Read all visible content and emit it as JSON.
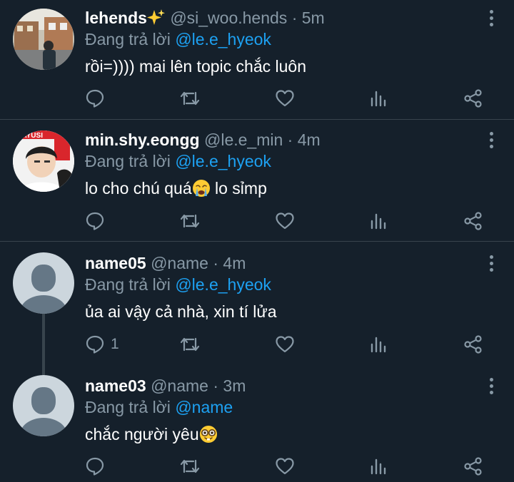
{
  "colors": {
    "background": "#15202b",
    "divider": "#38444d",
    "muted": "#8899a6",
    "accent": "#1da1f2"
  },
  "tweets": [
    {
      "display_name": "lehends",
      "name_emoji": "sparkles-icon",
      "handle": "@si_woo.hends",
      "separator": "·",
      "time": "5m",
      "replying_prefix": "Đang trả lời",
      "replying_to": "@le.e_hyeok",
      "text": "rồi=)))) mai lên topic chắc luôn",
      "reply_count": ""
    },
    {
      "display_name": "min.shy.eongg",
      "handle": "@le.e_min",
      "separator": "·",
      "time": "4m",
      "replying_prefix": "Đang trả lời",
      "replying_to": "@le.e_hyeok",
      "text_before": "lo cho chú quá",
      "text_emoji": "loudly-crying-face-icon",
      "text_after": " lo sỉmp",
      "avatar_text": "MAYUSI",
      "reply_count": ""
    },
    {
      "display_name": "name05",
      "handle": "@name",
      "separator": "·",
      "time": "4m",
      "replying_prefix": "Đang trả lời",
      "replying_to": "@le.e_hyeok",
      "text": "ủa ai vậy cả nhà, xin tí lửa",
      "reply_count": "1"
    },
    {
      "display_name": "name03",
      "handle": "@name",
      "separator": "·",
      "time": "3m",
      "replying_prefix": "Đang trả lời",
      "replying_to": "@name",
      "text_before": "chắc người yêu",
      "text_emoji": "nerd-face-icon",
      "reply_count": ""
    }
  ]
}
